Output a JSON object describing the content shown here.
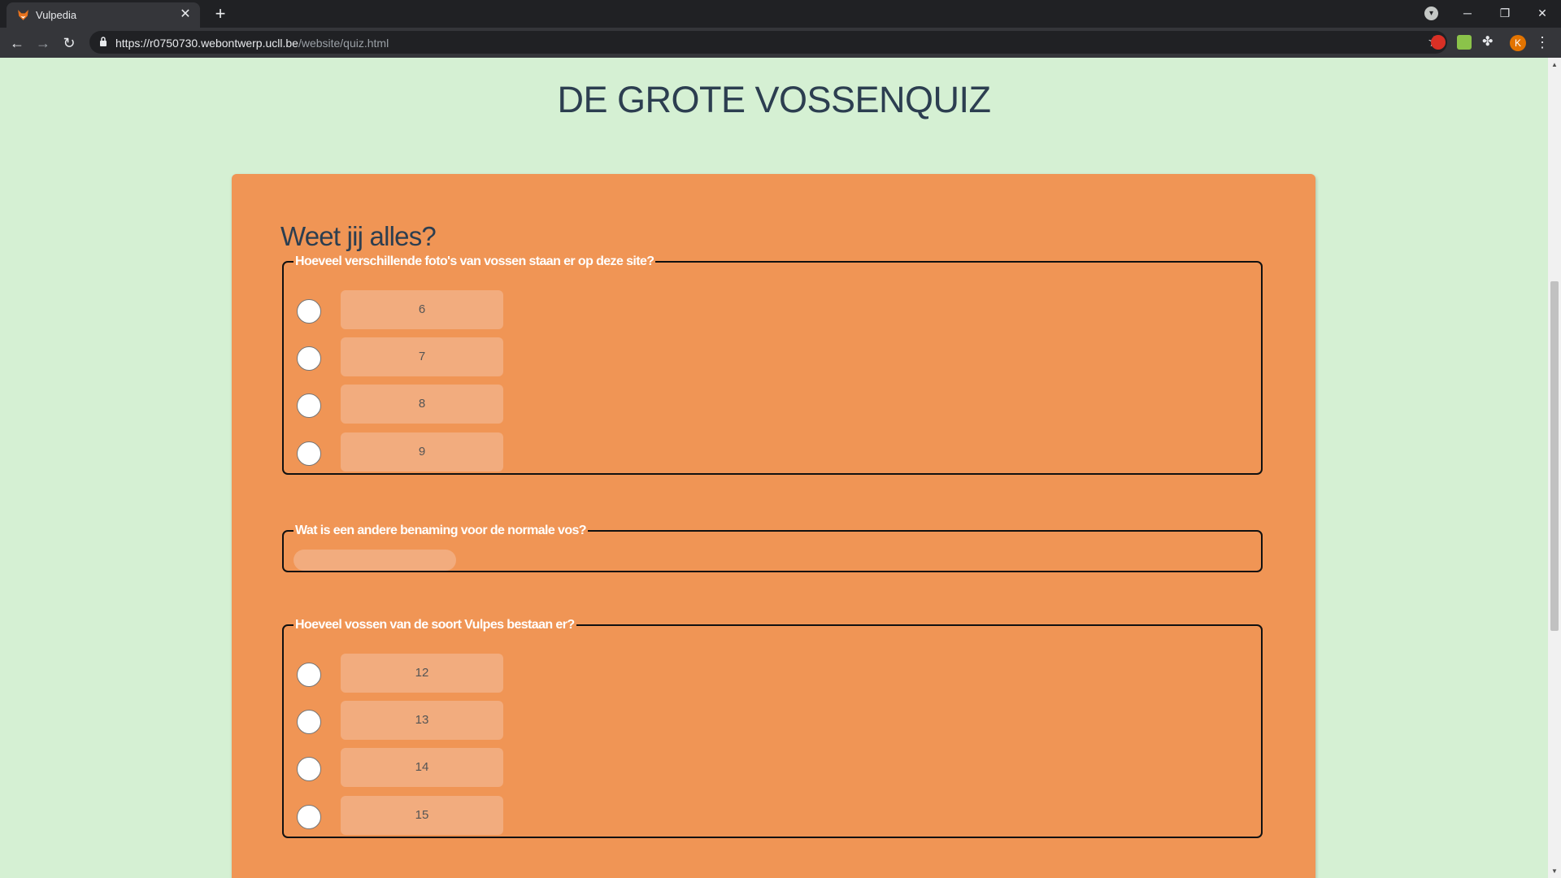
{
  "browser": {
    "tab_title": "Vulpedia",
    "tab_close": "✕",
    "new_tab": "+",
    "url_host": "https://r0750730.webontwerp.ucll.be",
    "url_path": "/website/quiz.html",
    "avatar_letter": "K"
  },
  "page": {
    "title": "DE GROTE VOSSENQUIZ",
    "quiz_heading": "Weet jij alles?"
  },
  "questions": [
    {
      "legend": "Hoeveel verschillende foto's van vossen staan er op deze site?",
      "type": "radio",
      "options": [
        "6",
        "7",
        "8",
        "9"
      ]
    },
    {
      "legend": "Wat is een andere benaming voor de normale vos?",
      "type": "text",
      "value": "",
      "placeholder": ""
    },
    {
      "legend": "Hoeveel vossen van de soort Vulpes bestaan er?",
      "type": "radio",
      "options": [
        "12",
        "13",
        "14",
        "15"
      ]
    }
  ],
  "colors": {
    "page_bg": "#d5f0d3",
    "card_bg": "#f09555",
    "option_bg": "#f2ac7e",
    "title_color": "#2c3e50"
  }
}
